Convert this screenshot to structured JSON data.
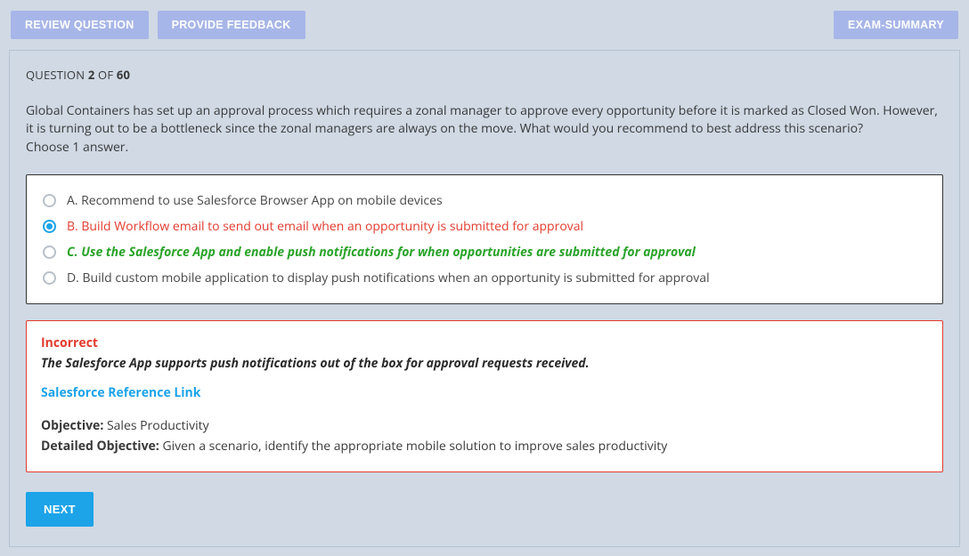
{
  "toolbar": {
    "review_label": "REVIEW QUESTION",
    "feedback_label": "PROVIDE FEEDBACK",
    "summary_label": "EXAM-SUMMARY"
  },
  "question": {
    "label_prefix": "QUESTION ",
    "number": "2",
    "of_text": " OF ",
    "total": "60",
    "text": "Global Containers has set up an approval process which requires a zonal manager to approve every opportunity before it is marked as Closed Won. However, it is turning out to be a bottleneck since the zonal managers are always on the move. What would you recommend to best address this scenario?",
    "instruction": "Choose 1 answer."
  },
  "answers": [
    {
      "label": "A. Recommend to use Salesforce Browser App on mobile devices",
      "state": "normal",
      "selected": false
    },
    {
      "label": "B. Build Workflow email to send out email when an opportunity is submitted for approval",
      "state": "wrong",
      "selected": true
    },
    {
      "label": "C. Use the Salesforce App and enable push notifications for when opportunities are submitted for approval",
      "state": "correct",
      "selected": false
    },
    {
      "label": "D. Build custom mobile application to display push notifications when an opportunity is submitted for approval",
      "state": "normal",
      "selected": false
    }
  ],
  "feedback": {
    "status": "Incorrect",
    "explanation": "The Salesforce App supports push notifications out of the box for approval requests received.",
    "reference_link_text": "Salesforce Reference Link",
    "objective_label": "Objective:",
    "objective_value": " Sales Productivity",
    "detailed_label": "Detailed Objective:",
    "detailed_value": " Given a scenario, identify the appropriate mobile solution to improve sales productivity"
  },
  "next_label": "NEXT"
}
